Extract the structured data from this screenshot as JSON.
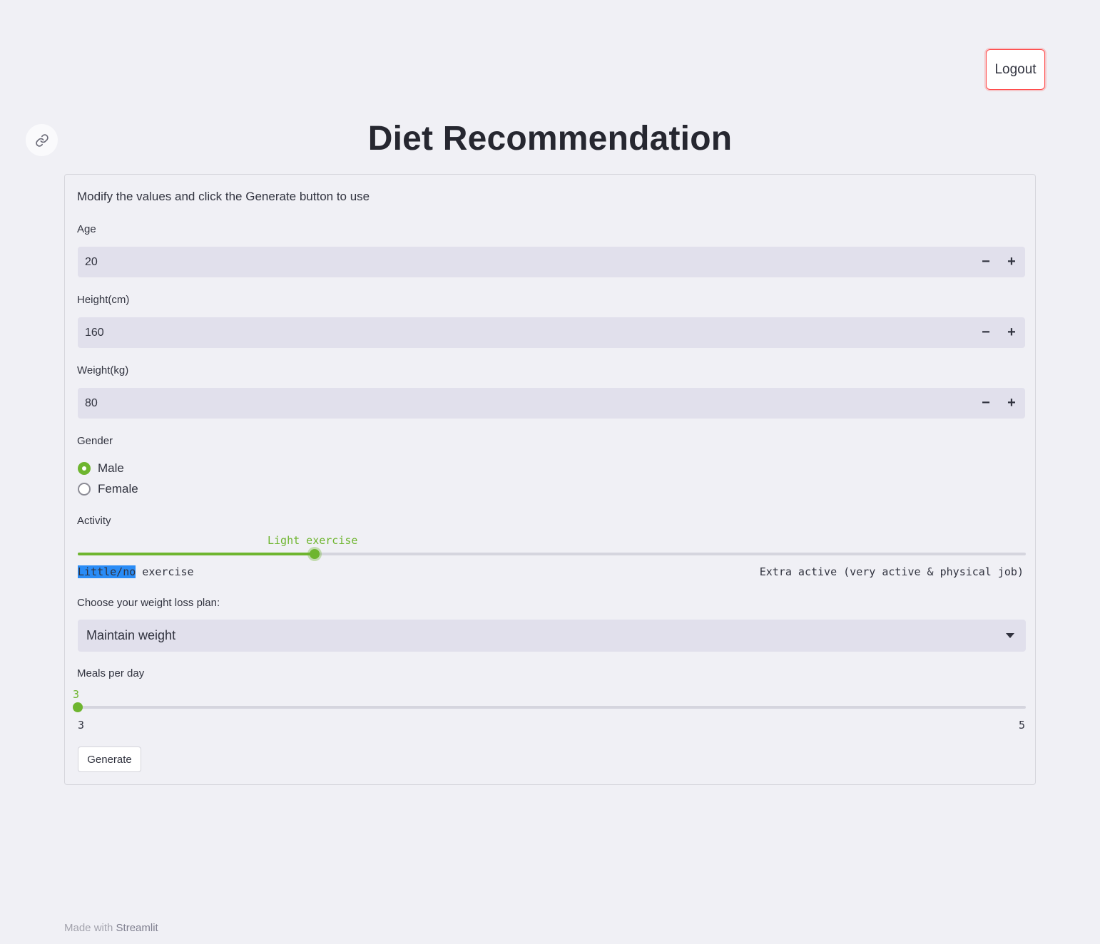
{
  "header": {
    "logout_label": "Logout",
    "title": "Diet Recommendation"
  },
  "form": {
    "intro": "Modify the values and click the Generate button to use",
    "age": {
      "label": "Age",
      "value": "20"
    },
    "height": {
      "label": "Height(cm)",
      "value": "160"
    },
    "weight": {
      "label": "Weight(kg)",
      "value": "80"
    },
    "stepper": {
      "minus": "−",
      "plus": "+"
    },
    "gender": {
      "label": "Gender",
      "options": [
        "Male",
        "Female"
      ],
      "selected": "Male"
    },
    "activity": {
      "label": "Activity",
      "current": "Light exercise",
      "min_label_selected": "Little/no",
      "min_label_rest": " exercise",
      "max_label": "Extra active (very active & physical job)",
      "level_fraction": 0.25
    },
    "plan": {
      "label": "Choose your weight loss plan:",
      "selected": "Maintain weight"
    },
    "meals": {
      "label": "Meals per day",
      "current": "3",
      "min": "3",
      "max": "5",
      "value": 3
    },
    "generate_label": "Generate"
  },
  "footer": {
    "prefix": "Made with",
    "brand": "Streamlit"
  },
  "colors": {
    "accent": "#6eb52f",
    "logout_border": "#ff4b4b",
    "input_bg": "#e1e0ec",
    "background": "#f0f0f5"
  }
}
